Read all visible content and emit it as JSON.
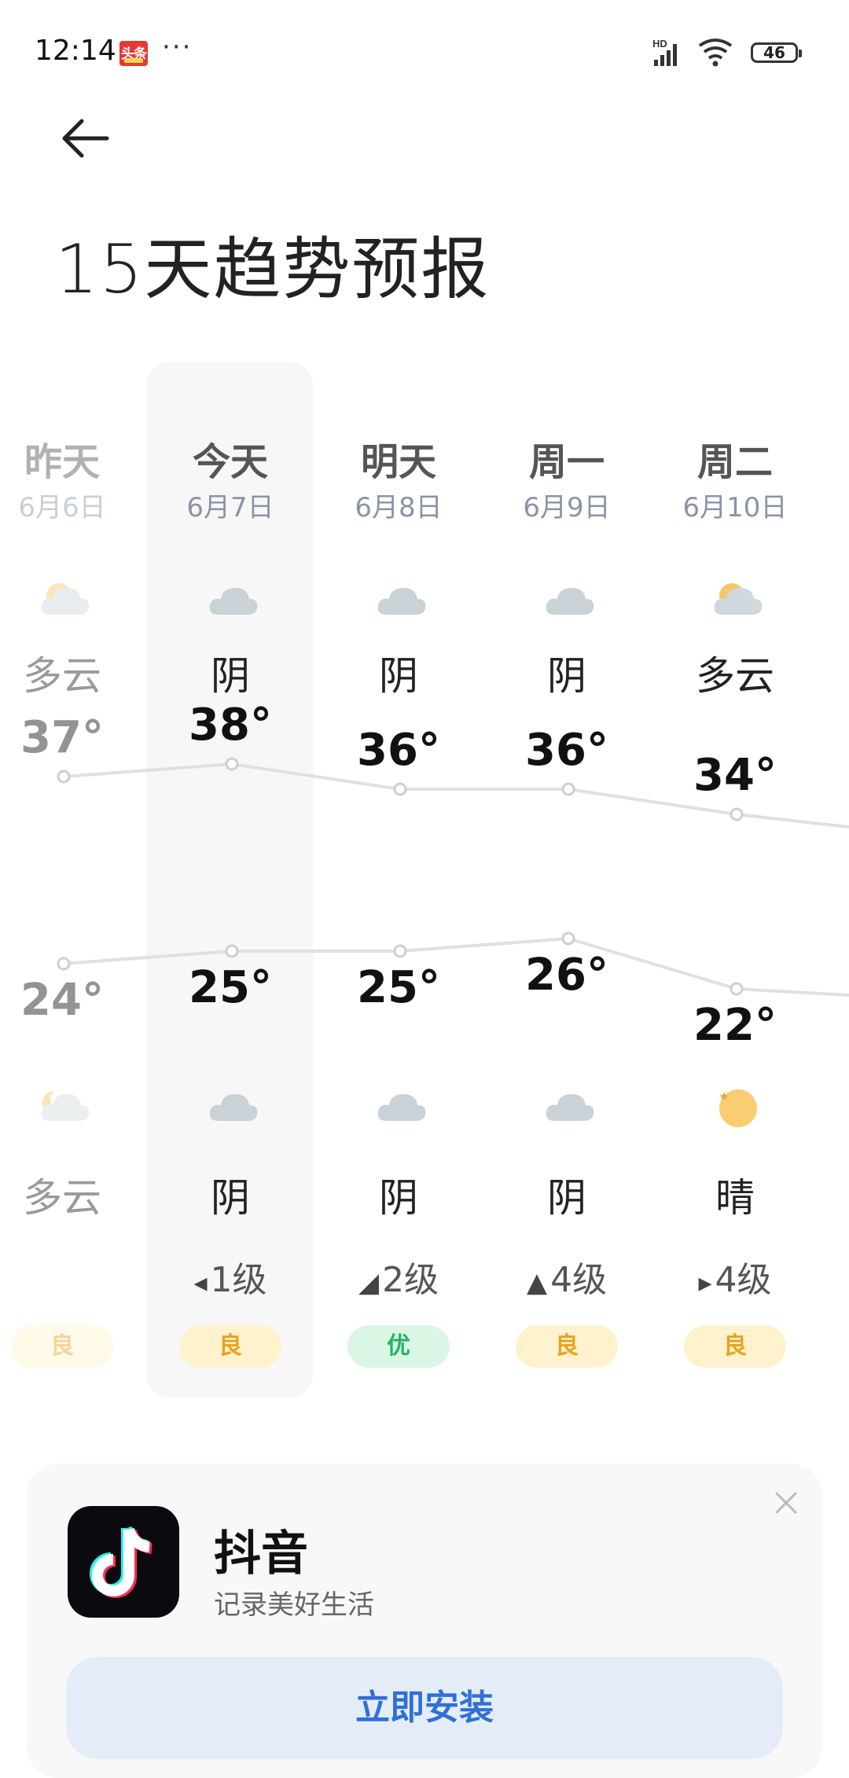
{
  "status_bar": {
    "time": "12:14",
    "news_app_label": "头条",
    "more_dots": "···",
    "network": "HD",
    "battery": "46"
  },
  "header": {
    "title": "15天趋势预报"
  },
  "forecast": {
    "days": [
      {
        "label": "昨天",
        "date": "6月6日",
        "day_cond": "多云",
        "day_icon": "partly-cloudy-day-icon",
        "high": "37°",
        "low": "24°",
        "night_icon": "partly-cloudy-night-icon",
        "night_cond": "多云",
        "wind": "",
        "aqi": "良",
        "aqi_level": "good"
      },
      {
        "label": "今天",
        "date": "6月7日",
        "day_cond": "阴",
        "day_icon": "cloud-icon",
        "high": "38°",
        "low": "25°",
        "night_icon": "cloud-icon",
        "night_cond": "阴",
        "wind": "1级",
        "wind_arrow": "◂",
        "aqi": "良",
        "aqi_level": "good"
      },
      {
        "label": "明天",
        "date": "6月8日",
        "day_cond": "阴",
        "day_icon": "cloud-icon",
        "high": "36°",
        "low": "25°",
        "night_icon": "cloud-icon",
        "night_cond": "阴",
        "wind": "2级",
        "wind_arrow": "◢",
        "aqi": "优",
        "aqi_level": "excellent"
      },
      {
        "label": "周一",
        "date": "6月9日",
        "day_cond": "阴",
        "day_icon": "cloud-icon",
        "high": "36°",
        "low": "26°",
        "night_icon": "cloud-icon",
        "night_cond": "阴",
        "wind": "4级",
        "wind_arrow": "▲",
        "aqi": "良",
        "aqi_level": "good"
      },
      {
        "label": "周二",
        "date": "6月10日",
        "day_cond": "多云",
        "day_icon": "partly-cloudy-day-icon",
        "high": "34°",
        "low": "22°",
        "night_icon": "moon-icon",
        "night_cond": "晴",
        "wind": "4级",
        "wind_arrow": "▸",
        "aqi": "良",
        "aqi_level": "good"
      }
    ],
    "colors": {
      "line": "#e0e0e0",
      "aqi_good": "#e8a321",
      "aqi_excellent": "#22b561"
    }
  },
  "chart_data": {
    "type": "line",
    "categories": [
      "昨天",
      "今天",
      "明天",
      "周一",
      "周二"
    ],
    "series": [
      {
        "values": [
          37,
          38,
          36,
          36,
          34
        ]
      },
      {
        "values": [
          24,
          25,
          25,
          26,
          22
        ]
      }
    ],
    "ylabel": "",
    "grid": false
  },
  "ad": {
    "app_name": "抖音",
    "tagline": "记录美好生活",
    "install_label": "立即安装",
    "close_icon": "close-icon"
  }
}
